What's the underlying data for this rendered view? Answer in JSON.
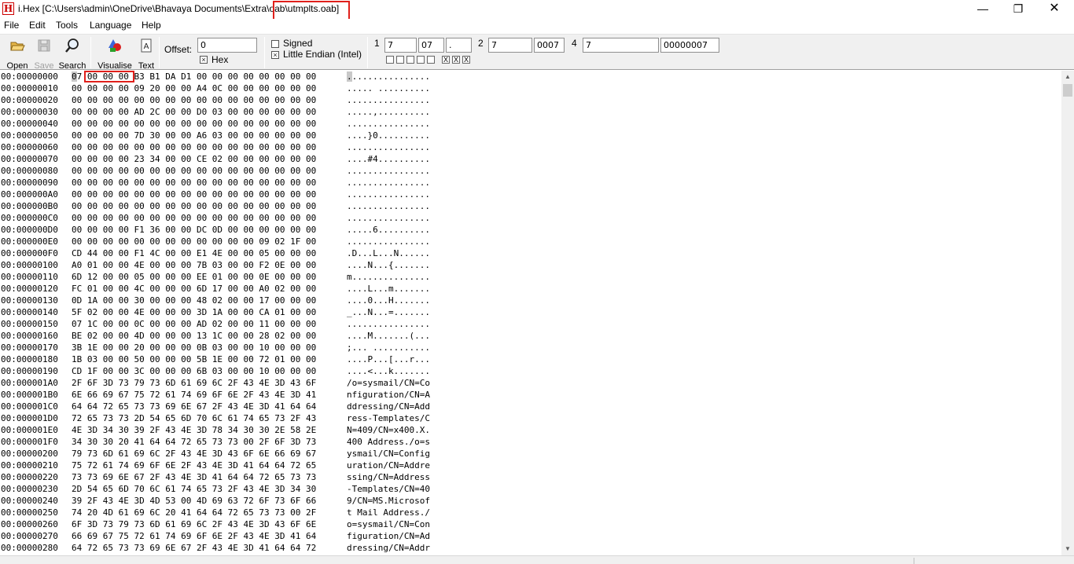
{
  "window": {
    "title": "i.Hex [C:\\Users\\admin\\OneDrive\\Bhavaya Documents\\Extra\\oab\\utmplts.oab]",
    "app_icon_letter": "H",
    "minimize": "—",
    "maximize": "❐",
    "close": "✕"
  },
  "menu": {
    "file": "File",
    "edit": "Edit",
    "tools": "Tools",
    "language": "Language",
    "help": "Help"
  },
  "toolbar": {
    "open": "Open",
    "save": "Save",
    "search": "Search",
    "visualise": "Visualise",
    "text": "Text",
    "offset_label": "Offset:",
    "offset_value": "0",
    "hex_label": "Hex",
    "hex_checked": true,
    "signed_label": "Signed",
    "signed_checked": false,
    "little_endian_label": "Little Endian (Intel)",
    "little_endian_checked": true,
    "byte1_label": "1",
    "byte1_dec": "7",
    "byte1_hex": "07",
    "byte1_char": ".",
    "word2_label": "2",
    "word2_dec": "7",
    "word2_hex": "0007",
    "dword4_label": "4",
    "dword4_dec": "7",
    "dword4_hex": "00000007",
    "bits": [
      "",
      "",
      "",
      "",
      "",
      "X",
      "X",
      "X"
    ]
  },
  "hex_rows": [
    {
      "addr": "00:00000000",
      "hex": "07 00 00 00 B3 B1 DA D1 00 00 00 00 00 00 00 00",
      "ascii": "................"
    },
    {
      "addr": "00:00000010",
      "hex": "00 00 00 00 09 20 00 00 A4 0C 00 00 00 00 00 00",
      "ascii": "..... .........."
    },
    {
      "addr": "00:00000020",
      "hex": "00 00 00 00 00 00 00 00 00 00 00 00 00 00 00 00",
      "ascii": "................"
    },
    {
      "addr": "00:00000030",
      "hex": "00 00 00 00 AD 2C 00 00 D0 03 00 00 00 00 00 00",
      "ascii": ".....,.........."
    },
    {
      "addr": "00:00000040",
      "hex": "00 00 00 00 00 00 00 00 00 00 00 00 00 00 00 00",
      "ascii": "................"
    },
    {
      "addr": "00:00000050",
      "hex": "00 00 00 00 7D 30 00 00 A6 03 00 00 00 00 00 00",
      "ascii": "....}0.........."
    },
    {
      "addr": "00:00000060",
      "hex": "00 00 00 00 00 00 00 00 00 00 00 00 00 00 00 00",
      "ascii": "................"
    },
    {
      "addr": "00:00000070",
      "hex": "00 00 00 00 23 34 00 00 CE 02 00 00 00 00 00 00",
      "ascii": "....#4.........."
    },
    {
      "addr": "00:00000080",
      "hex": "00 00 00 00 00 00 00 00 00 00 00 00 00 00 00 00",
      "ascii": "................"
    },
    {
      "addr": "00:00000090",
      "hex": "00 00 00 00 00 00 00 00 00 00 00 00 00 00 00 00",
      "ascii": "................"
    },
    {
      "addr": "00:000000A0",
      "hex": "00 00 00 00 00 00 00 00 00 00 00 00 00 00 00 00",
      "ascii": "................"
    },
    {
      "addr": "00:000000B0",
      "hex": "00 00 00 00 00 00 00 00 00 00 00 00 00 00 00 00",
      "ascii": "................"
    },
    {
      "addr": "00:000000C0",
      "hex": "00 00 00 00 00 00 00 00 00 00 00 00 00 00 00 00",
      "ascii": "................"
    },
    {
      "addr": "00:000000D0",
      "hex": "00 00 00 00 F1 36 00 00 DC 0D 00 00 00 00 00 00",
      "ascii": ".....6.........."
    },
    {
      "addr": "00:000000E0",
      "hex": "00 00 00 00 00 00 00 00 00 00 00 00 09 02 1F 00",
      "ascii": "................"
    },
    {
      "addr": "00:000000F0",
      "hex": "CD 44 00 00 F1 4C 00 00 E1 4E 00 00 05 00 00 00",
      "ascii": ".D...L...N......"
    },
    {
      "addr": "00:00000100",
      "hex": "A0 01 00 00 4E 00 00 00 7B 03 00 00 F2 0E 00 00",
      "ascii": "....N...{......."
    },
    {
      "addr": "00:00000110",
      "hex": "6D 12 00 00 05 00 00 00 EE 01 00 00 0E 00 00 00",
      "ascii": "m..............."
    },
    {
      "addr": "00:00000120",
      "hex": "FC 01 00 00 4C 00 00 00 6D 17 00 00 A0 02 00 00",
      "ascii": "....L...m......."
    },
    {
      "addr": "00:00000130",
      "hex": "0D 1A 00 00 30 00 00 00 48 02 00 00 17 00 00 00",
      "ascii": "....0...H......."
    },
    {
      "addr": "00:00000140",
      "hex": "5F 02 00 00 4E 00 00 00 3D 1A 00 00 CA 01 00 00",
      "ascii": "_...N...=......."
    },
    {
      "addr": "00:00000150",
      "hex": "07 1C 00 00 0C 00 00 00 AD 02 00 00 11 00 00 00",
      "ascii": "................"
    },
    {
      "addr": "00:00000160",
      "hex": "BE 02 00 00 4D 00 00 00 13 1C 00 00 28 02 00 00",
      "ascii": "....M.......(..."
    },
    {
      "addr": "00:00000170",
      "hex": "3B 1E 00 00 20 00 00 00 0B 03 00 00 10 00 00 00",
      "ascii": ";... ..........."
    },
    {
      "addr": "00:00000180",
      "hex": "1B 03 00 00 50 00 00 00 5B 1E 00 00 72 01 00 00",
      "ascii": "....P...[...r..."
    },
    {
      "addr": "00:00000190",
      "hex": "CD 1F 00 00 3C 00 00 00 6B 03 00 00 10 00 00 00",
      "ascii": "....<...k......."
    },
    {
      "addr": "00:000001A0",
      "hex": "2F 6F 3D 73 79 73 6D 61 69 6C 2F 43 4E 3D 43 6F",
      "ascii": "/o=sysmail/CN=Co"
    },
    {
      "addr": "00:000001B0",
      "hex": "6E 66 69 67 75 72 61 74 69 6F 6E 2F 43 4E 3D 41",
      "ascii": "nfiguration/CN=A"
    },
    {
      "addr": "00:000001C0",
      "hex": "64 64 72 65 73 73 69 6E 67 2F 43 4E 3D 41 64 64",
      "ascii": "ddressing/CN=Add"
    },
    {
      "addr": "00:000001D0",
      "hex": "72 65 73 73 2D 54 65 6D 70 6C 61 74 65 73 2F 43",
      "ascii": "ress-Templates/C"
    },
    {
      "addr": "00:000001E0",
      "hex": "4E 3D 34 30 39 2F 43 4E 3D 78 34 30 30 2E 58 2E",
      "ascii": "N=409/CN=x400.X."
    },
    {
      "addr": "00:000001F0",
      "hex": "34 30 30 20 41 64 64 72 65 73 73 00 2F 6F 3D 73",
      "ascii": "400 Address./o=s"
    },
    {
      "addr": "00:00000200",
      "hex": "79 73 6D 61 69 6C 2F 43 4E 3D 43 6F 6E 66 69 67",
      "ascii": "ysmail/CN=Config"
    },
    {
      "addr": "00:00000210",
      "hex": "75 72 61 74 69 6F 6E 2F 43 4E 3D 41 64 64 72 65",
      "ascii": "uration/CN=Addre"
    },
    {
      "addr": "00:00000220",
      "hex": "73 73 69 6E 67 2F 43 4E 3D 41 64 64 72 65 73 73",
      "ascii": "ssing/CN=Address"
    },
    {
      "addr": "00:00000230",
      "hex": "2D 54 65 6D 70 6C 61 74 65 73 2F 43 4E 3D 34 30",
      "ascii": "-Templates/CN=40"
    },
    {
      "addr": "00:00000240",
      "hex": "39 2F 43 4E 3D 4D 53 00 4D 69 63 72 6F 73 6F 66",
      "ascii": "9/CN=MS.Microsof"
    },
    {
      "addr": "00:00000250",
      "hex": "74 20 4D 61 69 6C 20 41 64 64 72 65 73 73 00 2F",
      "ascii": "t Mail Address./"
    },
    {
      "addr": "00:00000260",
      "hex": "6F 3D 73 79 73 6D 61 69 6C 2F 43 4E 3D 43 6F 6E",
      "ascii": "o=sysmail/CN=Con"
    },
    {
      "addr": "00:00000270",
      "hex": "66 69 67 75 72 61 74 69 6F 6E 2F 43 4E 3D 41 64",
      "ascii": "figuration/CN=Ad"
    },
    {
      "addr": "00:00000280",
      "hex": "64 72 65 73 73 69 6E 67 2F 43 4E 3D 41 64 64 72",
      "ascii": "dressing/CN=Addr"
    }
  ],
  "colors": {
    "highlight_box": "#e0201b",
    "toolbar_bg": "#f0f0f0",
    "cursor_bg": "#c8c8c8"
  },
  "icons": {
    "open": "folder-open-icon",
    "save": "floppy-disk-icon",
    "search": "magnifier-icon",
    "visualise": "shapes-icon",
    "text": "text-document-icon"
  }
}
